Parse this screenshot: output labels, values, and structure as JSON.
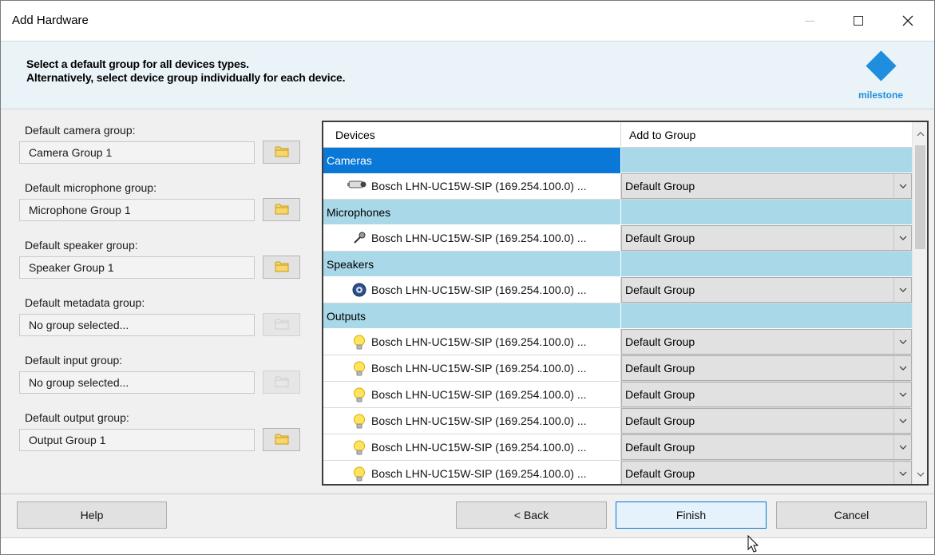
{
  "window": {
    "title": "Add Hardware"
  },
  "header": {
    "line1": "Select a default group for all devices types.",
    "line2": "Alternatively, select device group individually for each device.",
    "logo_text": "milestone",
    "logo_color": "#1f8ede"
  },
  "defaults": [
    {
      "label": "Default camera group:",
      "value": "Camera Group 1",
      "button_enabled": true
    },
    {
      "label": "Default microphone group:",
      "value": "Microphone Group 1",
      "button_enabled": true
    },
    {
      "label": "Default speaker group:",
      "value": "Speaker Group 1",
      "button_enabled": true
    },
    {
      "label": "Default metadata group:",
      "value": "No group selected...",
      "button_enabled": false
    },
    {
      "label": "Default input group:",
      "value": "No group selected...",
      "button_enabled": false
    },
    {
      "label": "Default output group:",
      "value": "Output Group 1",
      "button_enabled": true
    }
  ],
  "grid": {
    "columns": [
      "Devices",
      "Add to Group"
    ],
    "categories": [
      {
        "name": "Cameras",
        "selected": true,
        "icon": "camera-icon",
        "devices": [
          {
            "name": "Bosch LHN-UC15W-SIP (169.254.100.0) ...",
            "group": "Default Group"
          }
        ]
      },
      {
        "name": "Microphones",
        "selected": false,
        "icon": "microphone-icon",
        "devices": [
          {
            "name": "Bosch LHN-UC15W-SIP (169.254.100.0) ...",
            "group": "Default Group"
          }
        ]
      },
      {
        "name": "Speakers",
        "selected": false,
        "icon": "speaker-icon",
        "devices": [
          {
            "name": "Bosch LHN-UC15W-SIP (169.254.100.0) ...",
            "group": "Default Group"
          }
        ]
      },
      {
        "name": "Outputs",
        "selected": false,
        "icon": "lightbulb-icon",
        "devices": [
          {
            "name": "Bosch LHN-UC15W-SIP (169.254.100.0) ...",
            "group": "Default Group"
          },
          {
            "name": "Bosch LHN-UC15W-SIP (169.254.100.0) ...",
            "group": "Default Group"
          },
          {
            "name": "Bosch LHN-UC15W-SIP (169.254.100.0) ...",
            "group": "Default Group"
          },
          {
            "name": "Bosch LHN-UC15W-SIP (169.254.100.0) ...",
            "group": "Default Group"
          },
          {
            "name": "Bosch LHN-UC15W-SIP (169.254.100.0) ...",
            "group": "Default Group"
          },
          {
            "name": "Bosch LHN-UC15W-SIP (169.254.100.0) ...",
            "group": "Default Group"
          }
        ]
      }
    ]
  },
  "buttons": {
    "help": "Help",
    "back": "< Back",
    "finish": "Finish",
    "cancel": "Cancel"
  },
  "colors": {
    "category_bg": "#a9d8e8",
    "selected_bg": "#0a78d7",
    "header_bg": "#eaf4f8"
  }
}
